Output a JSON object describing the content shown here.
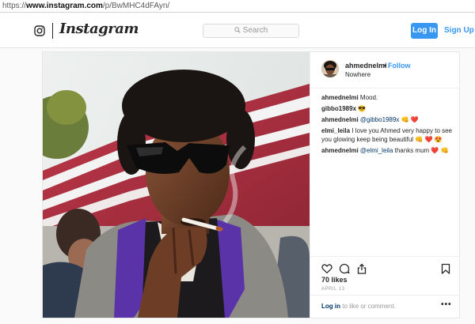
{
  "browser": {
    "url_scheme": "https://",
    "url_host": "www.instagram.com",
    "url_path": "/p/BwMHC4dFAyn/"
  },
  "header": {
    "wordmark": "Instagram",
    "search_placeholder": "Search",
    "login_button": "Log In",
    "signup_link": "Sign Up",
    "accent_color": "#3897f0"
  },
  "post": {
    "username": "ahmednelmi",
    "separator": "•",
    "follow_label": "Follow",
    "location": "Nowhere",
    "comments": [
      {
        "user": "ahmednelmi",
        "text": "Mood."
      },
      {
        "user": "gibbo1989x",
        "text": "😎"
      },
      {
        "user": "ahmednelmi",
        "mention": "@gibbo1989x",
        "text": "👊 ❤️"
      },
      {
        "user": "elmi_leila",
        "text": "I love you Ahmed very happy to see you glowing keep being beautiful 👊 ❤️ 😍"
      },
      {
        "user": "ahmednelmi",
        "mention": "@elmi_leila",
        "text": "thanks mum ❤️ 👊"
      }
    ],
    "likes": "70 likes",
    "date": "APRIL 13",
    "login_prompt_link": "Log in",
    "login_prompt_text": "to like or comment.",
    "more_label": "•••",
    "icons": [
      "heart-icon",
      "comment-icon",
      "share-icon",
      "bookmark-icon",
      "instagram-glyph-icon",
      "search-icon"
    ]
  }
}
